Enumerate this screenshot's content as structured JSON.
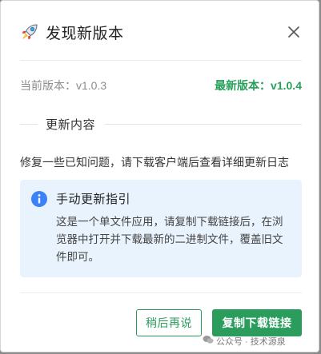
{
  "dialog": {
    "title": "发现新版本",
    "icon": "rocket-icon",
    "close_icon": "close-icon"
  },
  "version": {
    "current": "当前版本：v1.0.3",
    "latest": "最新版本：v1.0.4"
  },
  "changelog": {
    "section_title": "更新内容",
    "description": "修复一些已知问题，请下载客户端后查看详细更新日志"
  },
  "guide": {
    "icon": "info-icon",
    "title": "手动更新指引",
    "body": "这是一个单文件应用，请复制下载链接后，在浏览器中打开并下载最新的二进制文件，覆盖旧文件即可。"
  },
  "buttons": {
    "later": "稍后再说",
    "copy_link": "复制下载链接"
  },
  "watermark": {
    "text": "公众号 · 技术源泉"
  },
  "colors": {
    "accent": "#2a9d5c",
    "latest_version": "#27a05a",
    "info_blue": "#3b82f6",
    "guide_bg": "#e9f3fd"
  }
}
